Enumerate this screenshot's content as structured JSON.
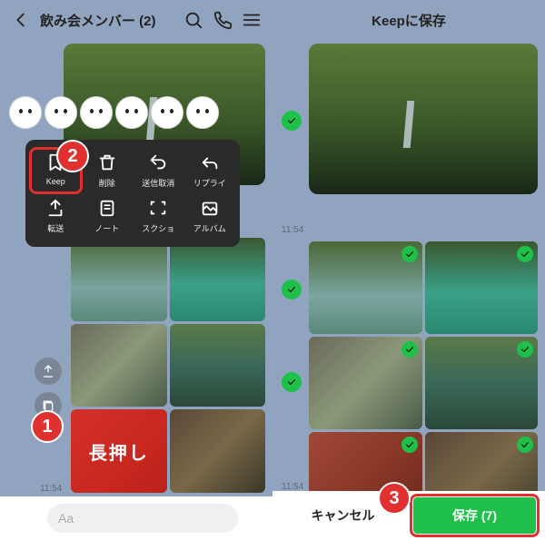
{
  "left": {
    "header": {
      "title": "飲み会メンバー (2)"
    },
    "popup": {
      "items": [
        {
          "label": "Keep",
          "icon": "bookmark"
        },
        {
          "label": "削除",
          "icon": "trash"
        },
        {
          "label": "送信取消",
          "icon": "undo"
        },
        {
          "label": "リプライ",
          "icon": "reply"
        },
        {
          "label": "転送",
          "icon": "share"
        },
        {
          "label": "ノート",
          "icon": "note"
        },
        {
          "label": "スクショ",
          "icon": "screenshot"
        },
        {
          "label": "アルバム",
          "icon": "album"
        }
      ]
    },
    "overlay_text": "長押し",
    "timestamp": "11:54",
    "input_placeholder": "Aa",
    "badges": {
      "one": "1",
      "two": "2"
    }
  },
  "right": {
    "header": {
      "title": "Keepに保存"
    },
    "timestamps": {
      "hero": "11:54",
      "grid": "11:54"
    },
    "footer": {
      "cancel": "キャンセル",
      "save": "保存 (7)"
    },
    "badge": "3"
  }
}
